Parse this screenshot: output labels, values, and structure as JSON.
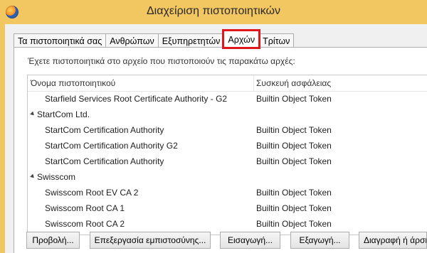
{
  "window": {
    "title": "Διαχείριση πιστοποιητικών",
    "icon": "firefox-icon"
  },
  "tabs": [
    {
      "label": "Τα πιστοποιητικά σας",
      "active": false
    },
    {
      "label": "Ανθρώπων",
      "active": false
    },
    {
      "label": "Εξυπηρετητών",
      "active": false
    },
    {
      "label": "Αρχών",
      "active": true
    },
    {
      "label": "Τρίτων",
      "active": false
    }
  ],
  "intro": "Έχετε πιστοποιητικά στο αρχείο που πιστοποιούν τις παρακάτω αρχές:",
  "table": {
    "columns": [
      "Όνομα πιστοποιητικού",
      "Συσκευή ασφάλειας"
    ],
    "rows": [
      {
        "type": "cert",
        "name": "Starfield Services Root Certificate Authority - G2",
        "device": "Builtin Object Token"
      },
      {
        "type": "group",
        "name": "StartCom Ltd.",
        "device": ""
      },
      {
        "type": "cert",
        "name": "StartCom Certification Authority",
        "device": "Builtin Object Token"
      },
      {
        "type": "cert",
        "name": "StartCom Certification Authority G2",
        "device": "Builtin Object Token"
      },
      {
        "type": "cert",
        "name": "StartCom Certification Authority",
        "device": "Builtin Object Token"
      },
      {
        "type": "group",
        "name": "Swisscom",
        "device": ""
      },
      {
        "type": "cert",
        "name": "Swisscom Root EV CA 2",
        "device": "Builtin Object Token"
      },
      {
        "type": "cert",
        "name": "Swisscom Root CA 1",
        "device": "Builtin Object Token"
      },
      {
        "type": "cert",
        "name": "Swisscom Root CA 2",
        "device": "Builtin Object Token"
      }
    ]
  },
  "buttons": {
    "view": "Προβολή...",
    "edit_trust": "Επεξεργασία εμπιστοσύνης...",
    "import": "Εισαγωγή...",
    "export": "Εξαγωγή...",
    "delete": "Διαγραφή ή άρση εμπιστοσύνης..."
  },
  "colors": {
    "highlight": "#e0161e",
    "titlebar": "#f2c660"
  }
}
